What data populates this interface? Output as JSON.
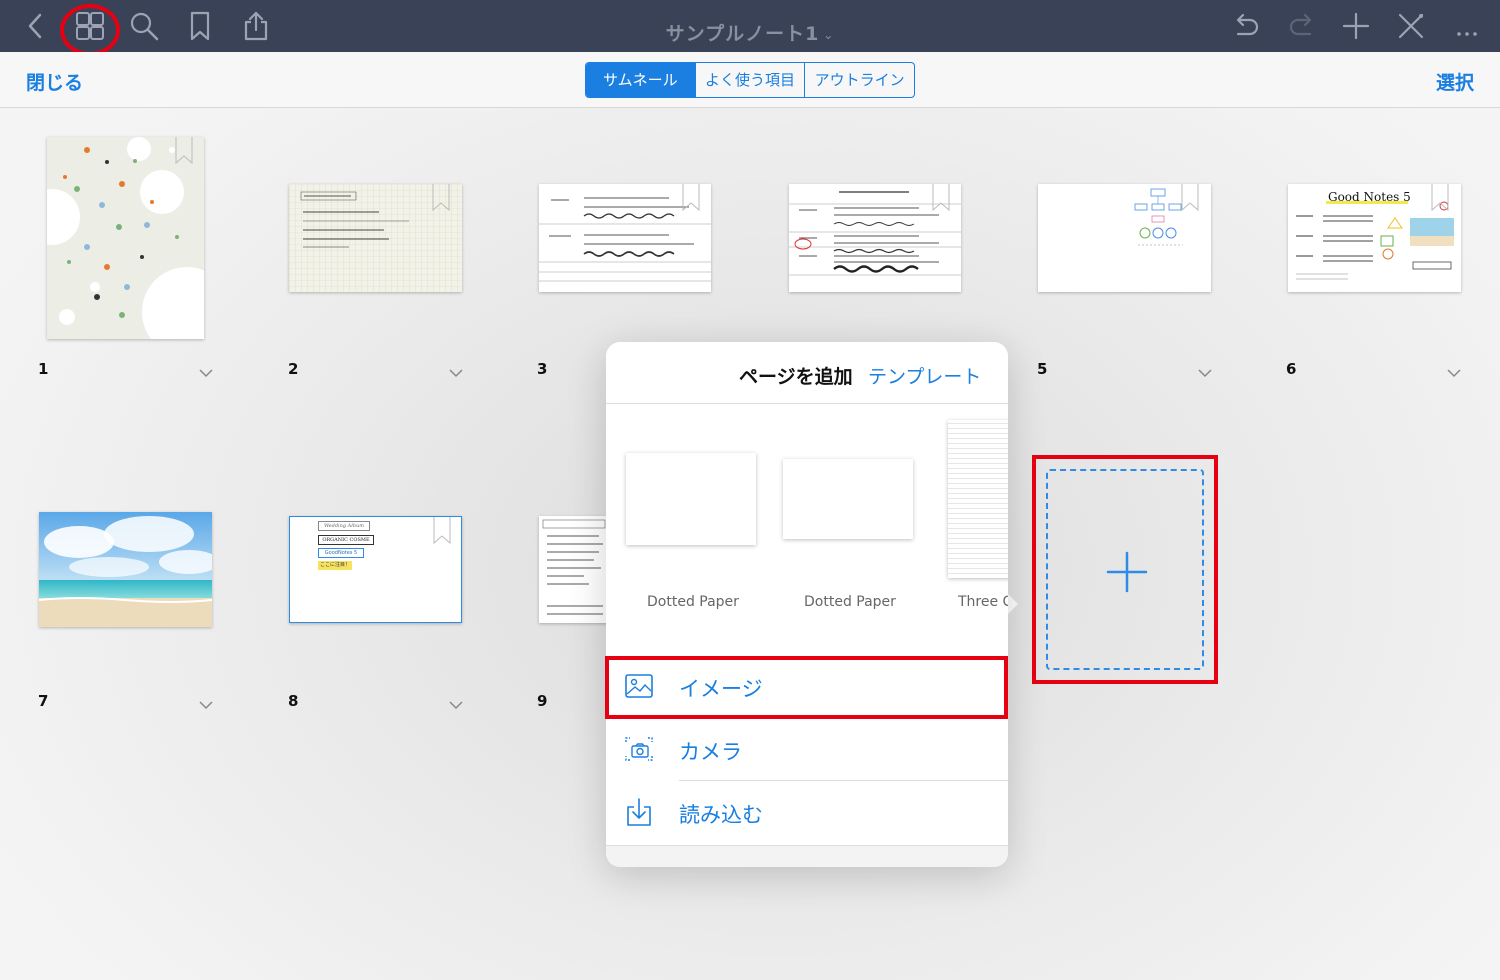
{
  "topbar": {
    "title": "サンプルノート1",
    "title_chevron": "⌄",
    "icons": [
      "back-icon",
      "grid-icon",
      "search-icon",
      "bookmark-icon",
      "share-icon",
      "undo-icon",
      "redo-icon",
      "add-icon",
      "close-icon",
      "more-icon"
    ]
  },
  "subbar": {
    "close_label": "閉じる",
    "select_label": "選択",
    "segments": [
      "サムネール",
      "よく使う項目",
      "アウトライン"
    ],
    "active_segment": 0
  },
  "pages": [
    {
      "number": "1"
    },
    {
      "number": "2"
    },
    {
      "number": "3"
    },
    {
      "number": "5"
    },
    {
      "number": "6"
    },
    {
      "number": "7"
    },
    {
      "number": "8"
    },
    {
      "number": "9"
    }
  ],
  "thumb_text": {
    "p6_title": "Good Notes 5",
    "p8_title": "Wedding Album",
    "p8_label1": "ORGANIC COSME",
    "p8_label2": "GoodNotes 5",
    "p8_label3": "ここに注目！",
    "p4_title": "ペンの比較（0.4mm）"
  },
  "popover": {
    "title": "ページを追加",
    "template_link": "テンプレート",
    "templates": [
      "Dotted Paper",
      "Dotted Paper",
      "Three C"
    ],
    "items": [
      {
        "label": "イメージ",
        "icon": "image-icon"
      },
      {
        "label": "カメラ",
        "icon": "camera-icon"
      },
      {
        "label": "読み込む",
        "icon": "import-icon"
      }
    ]
  },
  "colors": {
    "topbar": "#3a4257",
    "accent": "#1a7fe0",
    "highlight": "#e60012"
  }
}
